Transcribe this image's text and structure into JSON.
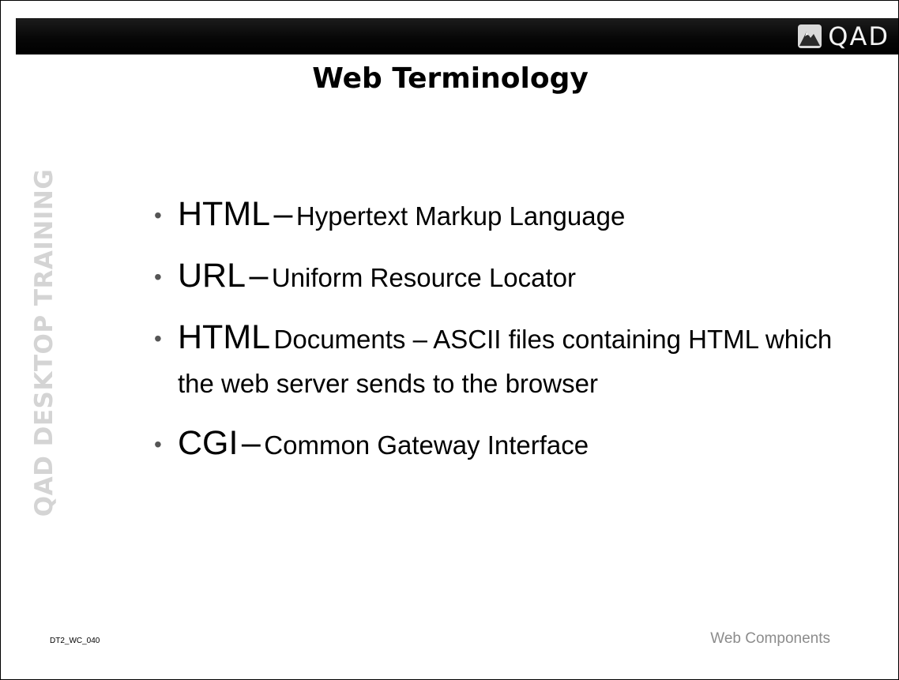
{
  "header": {
    "logo_text": "QAD",
    "logo_icon": "qad-mountain-logo-icon",
    "bar_color": "#000000"
  },
  "title": "Web Terminology",
  "side_label": "QAD DESKTOP TRAINING",
  "bullets": [
    {
      "term": "HTML",
      "dash": "–",
      "desc": "Hypertext Markup Language"
    },
    {
      "term": "URL",
      "dash": "–",
      "desc": "Uniform Resource Locator"
    },
    {
      "term": "HTML",
      "dash": "",
      "desc": "Documents – ASCII files containing HTML which the web server sends to the browser"
    },
    {
      "term": "CGI",
      "dash": "–",
      "desc": "Common Gateway Interface"
    }
  ],
  "footer": {
    "code": "DT2_WC_040",
    "topic": "Web Components"
  }
}
